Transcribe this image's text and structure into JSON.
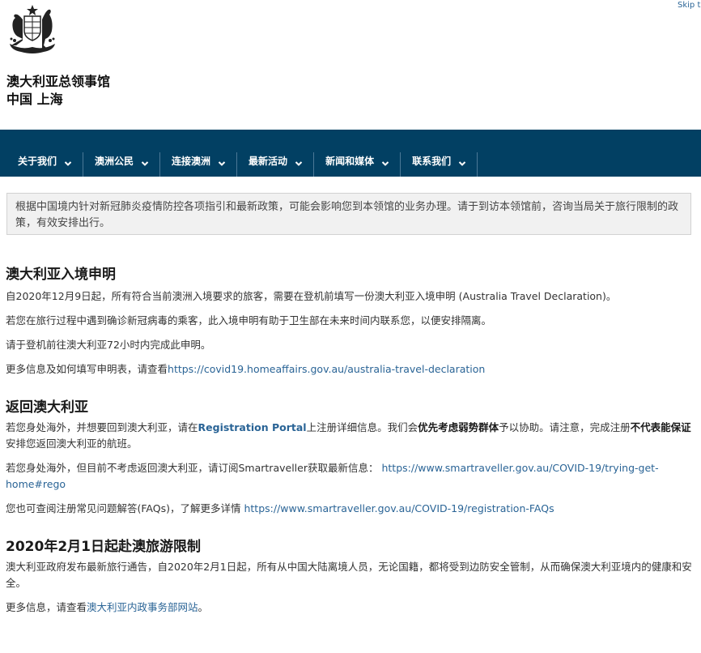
{
  "skip_link": "Skip to",
  "site": {
    "title_line1": "澳大利亚总领事馆",
    "title_line2": "中国 上海"
  },
  "nav": {
    "items": [
      {
        "label": "关于我们"
      },
      {
        "label": "澳洲公民"
      },
      {
        "label": "连接澳洲"
      },
      {
        "label": "最新活动"
      },
      {
        "label": "新闻和媒体"
      },
      {
        "label": "联系我们"
      }
    ]
  },
  "notice": "根据中国境内针对新冠肺炎疫情防控各项指引和最新政策，可能会影响您到本领馆的业务办理。请于到访本领馆前，咨询当局关于旅行限制的政策，有效安排出行。",
  "sections": {
    "declaration": {
      "heading": "澳大利亚入境申明",
      "p1": "自2020年12月9日起，所有符合当前澳洲入境要求的旅客，需要在登机前填写一份澳大利亚入境申明 (Australia Travel Declaration)。",
      "p2": "若您在旅行过程中遇到确诊新冠病毒的乘客，此入境申明有助于卫生部在未来时间内联系您，以便安排隔离。",
      "p3": "请于登机前往澳大利亚72小时内完成此申明。",
      "p4_text": "更多信息及如何填写申明表，请查看",
      "p4_link": "https://covid19.homeaffairs.gov.au/australia-travel-declaration"
    },
    "return": {
      "heading": "返回澳大利亚",
      "p1_a": "若您身处海外，并想要回到澳大利亚，请在",
      "p1_link": "Registration Portal",
      "p1_b": "上注册详细信息。我们会",
      "p1_bold1": "优先考虑弱势群体",
      "p1_c": "予以协助。请注意，完成注册",
      "p1_bold2": "不代表能保证",
      "p1_d": "安排您返回澳大利亚的航班。",
      "p2_text": "若您身处海外，但目前不考虑返回澳大利亚，请订阅Smartraveller获取最新信息：",
      "p2_link": "https://www.smartraveller.gov.au/COVID-19/trying-get-home#rego",
      "p3_text": "您也可查阅注册常见问题解答(FAQs)，了解更多详情",
      "p3_link": "https://www.smartraveller.gov.au/COVID-19/registration-FAQs"
    },
    "restriction": {
      "heading": "2020年2月1日起赴澳旅游限制",
      "p1": "澳大利亚政府发布最新旅行通告，自2020年2月1日起，所有从中国大陆离境人员，无论国籍，都将受到边防安全管制，从而确保澳大利亚境内的健康和安全。",
      "p2_text": "更多信息，请查看",
      "p2_link": "澳大利亚内政事务部网站",
      "p2_end": "。"
    }
  },
  "icons": {
    "crest": "coat-of-arms-icon",
    "nav_chevron": "chevron-down-icon"
  },
  "colors": {
    "nav_bg": "#024063",
    "link": "#2a6496",
    "notice_bg": "#f1f1f1"
  }
}
